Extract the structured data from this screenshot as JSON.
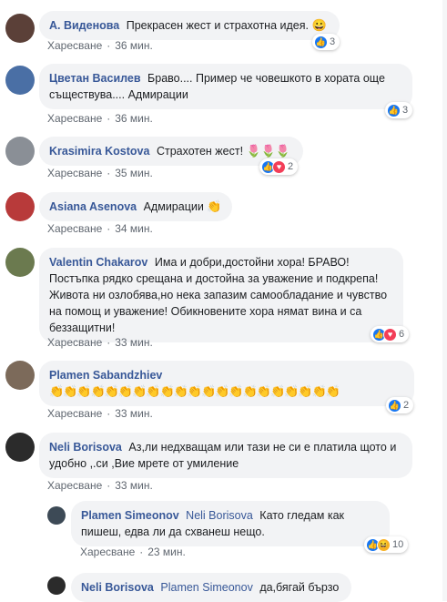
{
  "comments": [
    {
      "name": "А. Виденова",
      "text": "Прекрасен жест и страхотна идея.",
      "emoji": "😀",
      "like": "Харесване",
      "time": "36 мин.",
      "reactions": {
        "count": "3",
        "types": [
          "like"
        ]
      },
      "avatar_color": "#5b4038"
    },
    {
      "name": "Цветан Василев",
      "text": "Браво.... Пример че човешкото в хората още съществува.... Адмирации",
      "like": "Харесване",
      "time": "36 мин.",
      "reactions": {
        "count": "3",
        "types": [
          "like"
        ]
      },
      "avatar_color": "#4a6fa5"
    },
    {
      "name": "Krasimira Kostova",
      "text": "Страхотен жест!",
      "emoji": "🌷🌷🌷",
      "like": "Харесване",
      "time": "35 мин.",
      "reactions": {
        "count": "2",
        "types": [
          "like",
          "love"
        ]
      },
      "avatar_color": "#8a8f96"
    },
    {
      "name": "Asiana Asenova",
      "text": "Адмирации",
      "emoji": "👏",
      "like": "Харесване",
      "time": "34 мин.",
      "avatar_color": "#b83a3a"
    },
    {
      "name": "Valentin Chakarov",
      "text": "Има и добри,достойни хора! БРАВО! Постъпка рядко срещана и достойна за уважение и подкрепа! Живота ни озлобява,но нека запазим самообладание и чувство на помощ и уважение! Обикновените хора нямат вина и са беззащитни!",
      "like": "Харесване",
      "time": "33 мин.",
      "reactions": {
        "count": "6",
        "types": [
          "like",
          "love"
        ]
      },
      "avatar_color": "#6b7a4f"
    },
    {
      "name": "Plamen Sabandzhiev",
      "text": "",
      "emoji": "👏👏👏👏👏👏👏👏👏👏👏👏👏👏👏👏👏👏👏👏👏",
      "like": "Харесване",
      "time": "33 мин.",
      "reactions": {
        "count": "2",
        "types": [
          "like"
        ]
      },
      "avatar_color": "#7c6a5a"
    },
    {
      "name": "Neli Borisova",
      "text": "Аз,ли недхващам или тази не си е платила щото и удобно ,.си ,Вие мрете от умиление",
      "like": "Харесване",
      "time": "33 мин.",
      "avatar_color": "#2b2b2b"
    }
  ],
  "replies": [
    {
      "name": "Plamen Simeonov",
      "tag": "Neli Borisova",
      "text": "Като гледам как пишеш, едва ли да схванеш нещо.",
      "like": "Харесване",
      "time": "23 мин.",
      "reactions": {
        "count": "10",
        "types": [
          "like",
          "haha"
        ]
      },
      "avatar_color": "#3d4a56"
    },
    {
      "name": "Neli Borisova",
      "tag": "Plamen Simeonov",
      "text": "да,бягай бързо",
      "avatar_color": "#2b2b2b"
    }
  ],
  "icons": {
    "like": "thumbs-up-icon",
    "love": "heart-icon",
    "haha": "laughing-face-icon"
  },
  "colors": {
    "name_link": "#385898",
    "bubble_bg": "#f2f3f5",
    "meta_text": "#606770",
    "like_blue": "#1877f2",
    "love_red": "#f33e58"
  }
}
